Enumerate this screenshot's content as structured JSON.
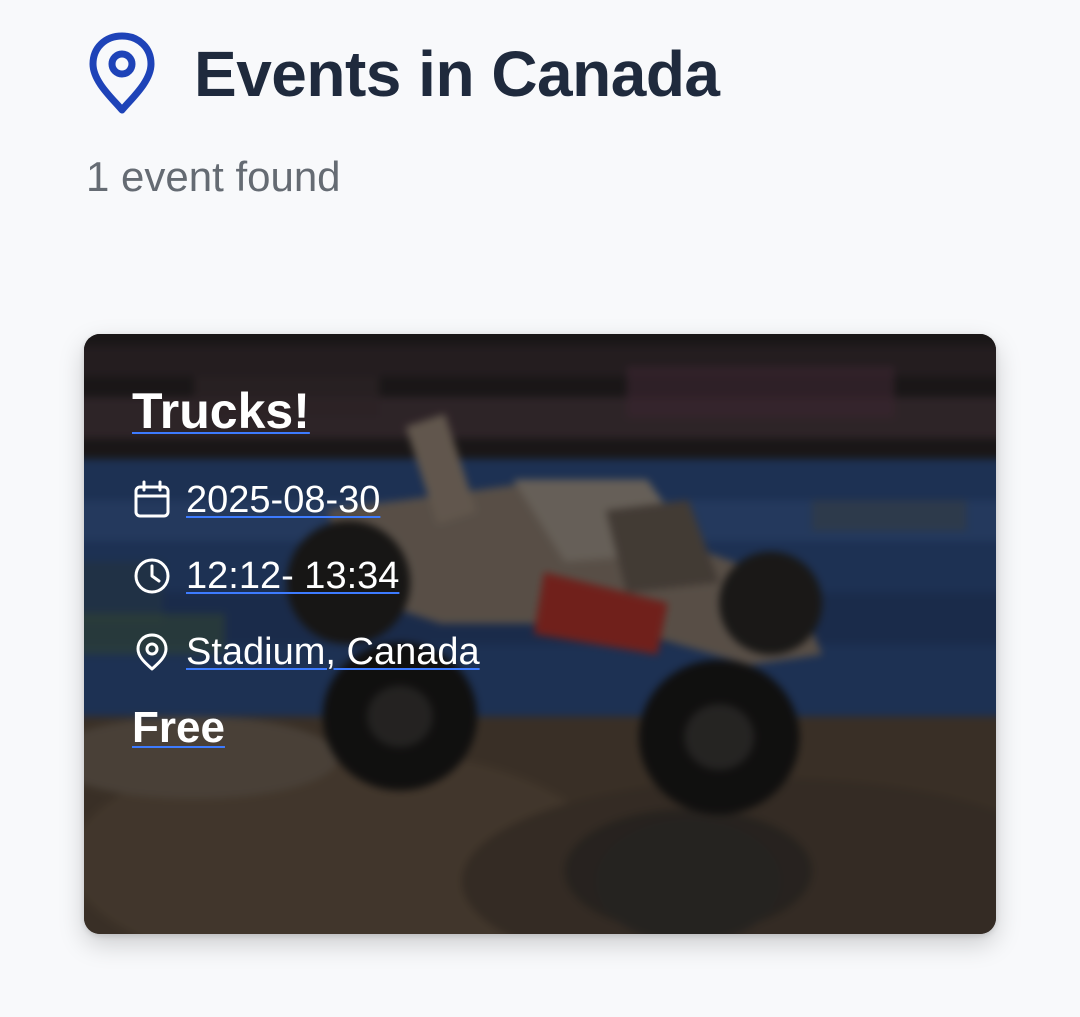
{
  "header": {
    "title": "Events in Canada",
    "icon": "map-pin-icon",
    "accent_color": "#1e43b8"
  },
  "results": {
    "count_text": "1 event found"
  },
  "events": [
    {
      "title": "Trucks!",
      "date": "2025-08-30",
      "time": "12:12- 13:34",
      "location": "Stadium, Canada",
      "price": "Free",
      "icons": {
        "date": "calendar-icon",
        "time": "clock-icon",
        "location": "map-pin-icon"
      },
      "image": "monster-truck-photo"
    }
  ],
  "colors": {
    "title_text": "#1f2a3d",
    "subtitle_text": "#656b73",
    "link_underline": "#3d7bff"
  }
}
